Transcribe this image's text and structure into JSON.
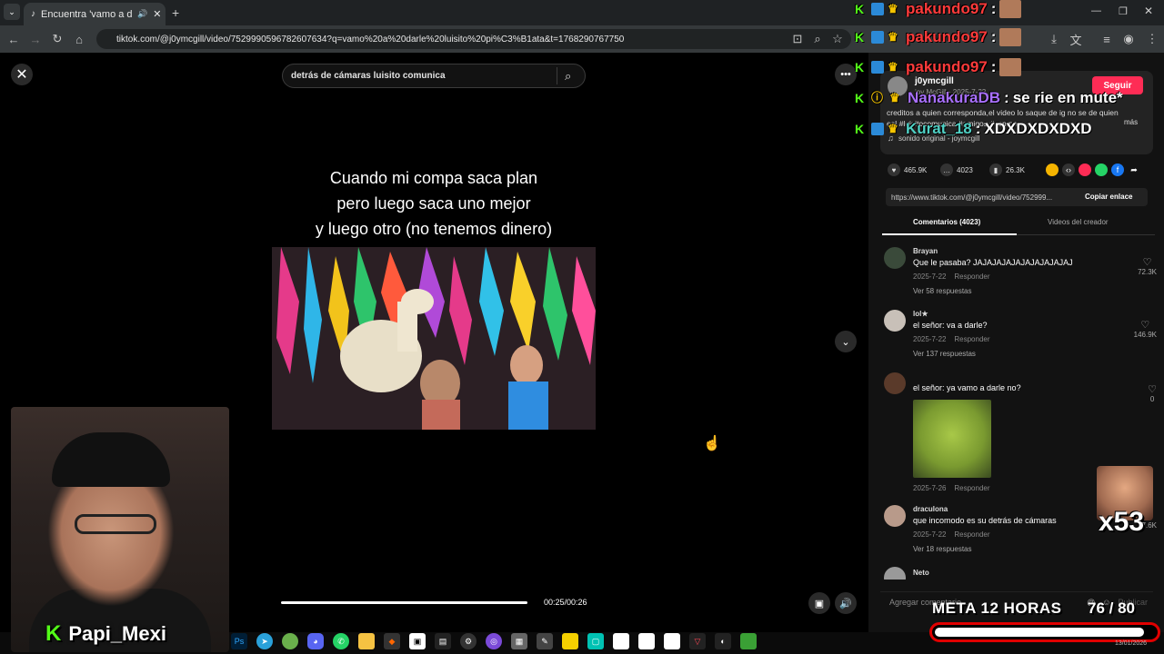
{
  "browser": {
    "tab_title": "Encuentra 'vamo a darle lu",
    "new_tab_symbol": "+",
    "url": "tiktok.com/@j0ymcgill/video/7529990596782607634?q=vamo%20a%20darle%20luisito%20pi%C3%B1ata&t=1768290767750"
  },
  "video": {
    "search_value": "detrás de cámaras luisito comunica",
    "caption_lines": [
      "Cuando mi compa saca plan",
      "pero luego saca uno mejor",
      "y luego otro (no tenemos dinero)"
    ],
    "time": "00:25/00:26",
    "progress_fraction": 0.96
  },
  "creator": {
    "username": "j0ymcgill",
    "sub": "joy McGill · 2025-7-22",
    "follow_label": "Seguir",
    "description": "creditos a quien corresponda,el video lo saque de ig no se de quien es! #luisitocomunica #amigos #compas",
    "more": "más",
    "sound": "sonido original - joymcgill"
  },
  "stats": {
    "likes": "465.9K",
    "comments": "4023",
    "saves": "26.3K"
  },
  "link": {
    "url": "https://www.tiktok.com/@j0ymcgill/video/752999...",
    "copy_label": "Copiar enlace"
  },
  "tabs": {
    "comments": "Comentarios (4023)",
    "creator_videos": "Videos del creador"
  },
  "comments": [
    {
      "user": "Brayan",
      "text": "Que le pasaba? JAJAJAJAJAJAJAJAJAJAJ",
      "date": "2025-7-22",
      "reply": "Responder",
      "replies": "Ver 58 respuestas",
      "likes": "72.3K"
    },
    {
      "user": "lol★",
      "text": "el señor: va a darle?",
      "date": "2025-7-22",
      "reply": "Responder",
      "replies": "Ver 137 respuestas",
      "likes": "146.9K"
    },
    {
      "user": "",
      "text": "el señor: ya vamo a darle no?",
      "date": "2025-7-26",
      "reply": "Responder",
      "replies": "",
      "likes": "0"
    },
    {
      "user": "draculona",
      "text": "que incomodo es su detrás de cámaras",
      "date": "2025-7-22",
      "reply": "Responder",
      "replies": "Ver 18 respuestas",
      "likes": "7.6K"
    },
    {
      "user": "Neto",
      "text": "",
      "date": "",
      "reply": "",
      "replies": "",
      "likes": ""
    }
  ],
  "comment_input": {
    "placeholder": "Agregar comentario...",
    "post_label": "Publicar"
  },
  "stream": {
    "streamer": "Papi_Mexi",
    "chat": [
      {
        "user": "pakundo97",
        "sep": ":",
        "text": "",
        "color": "#ff3b3b"
      },
      {
        "user": "pakundo97",
        "sep": ":",
        "text": "",
        "color": "#ff3b3b"
      },
      {
        "user": "pakundo97",
        "sep": ":",
        "text": "",
        "color": "#ff3b3b"
      },
      {
        "user": "NanakuraDB",
        "sep": ":",
        "text": "se rie en mute*",
        "color": "#a970ff"
      },
      {
        "user": "Kurat_18",
        "sep": ":",
        "text": "XDXDXDXDXD",
        "color": "#4fd1c5"
      }
    ],
    "goal_label": "META 12 HORAS",
    "goal_count": "76 / 80",
    "goal_fraction": 0.95,
    "multiplier": "x53"
  },
  "taskbar": {
    "clock": "13/01/2026"
  }
}
